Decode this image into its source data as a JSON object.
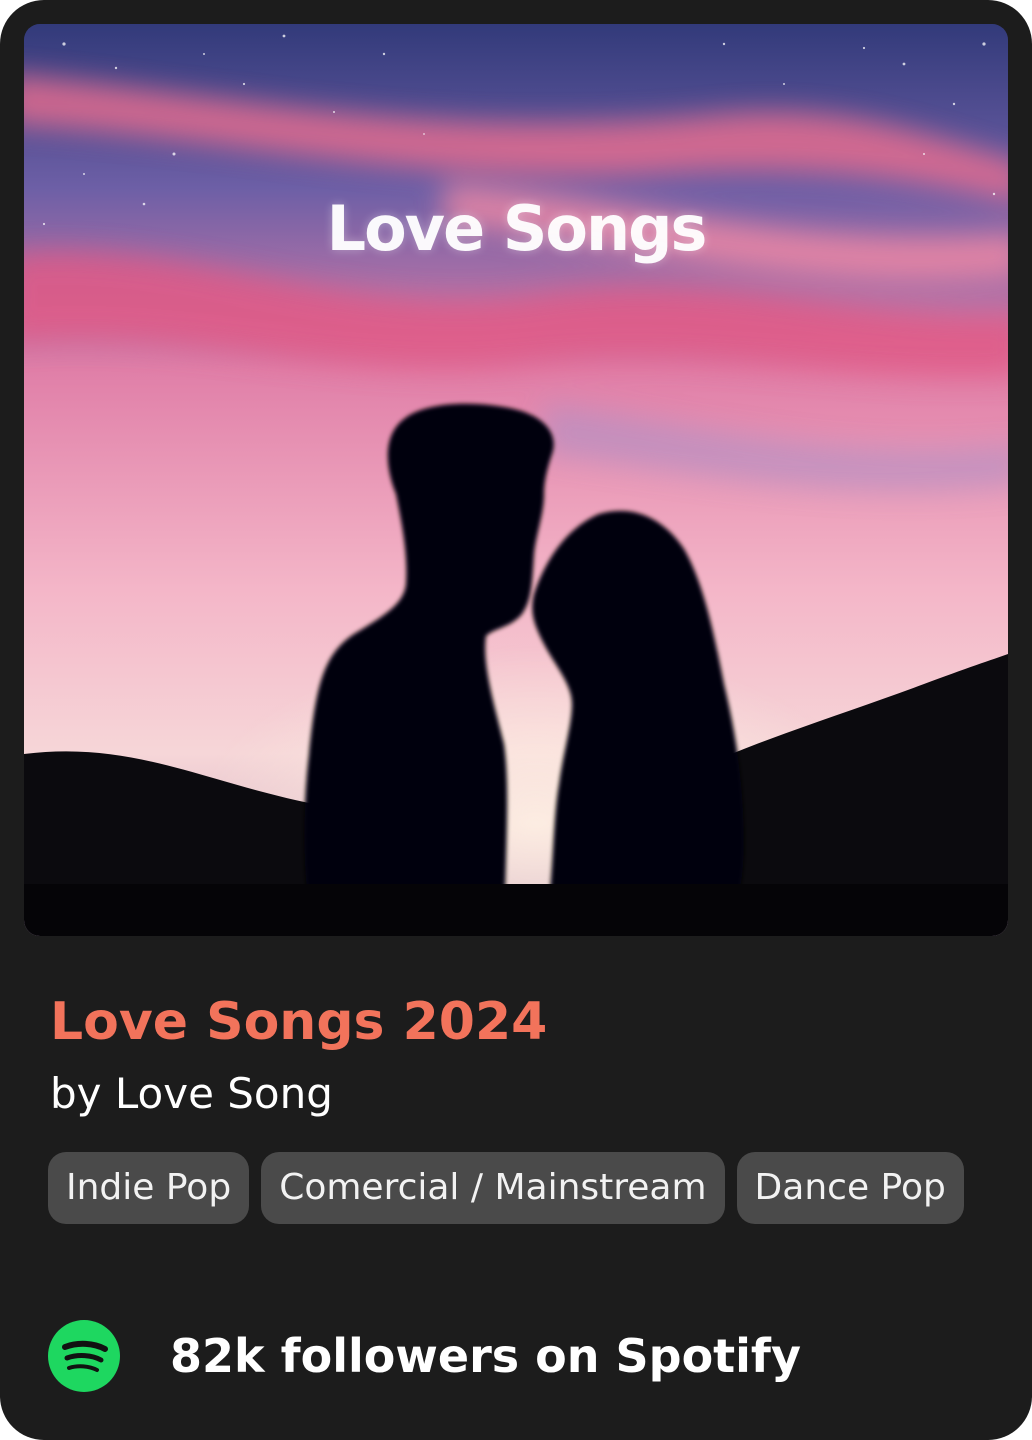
{
  "cover": {
    "title": "Love Songs",
    "image": "couple-silhouette-pink-sky"
  },
  "playlist": {
    "title": "Love Songs 2024",
    "author": "by Love Song",
    "title_color": "#f2735b"
  },
  "tags": [
    {
      "label": "Indie Pop"
    },
    {
      "label": "Comercial / Mainstream"
    },
    {
      "label": "Dance Pop"
    }
  ],
  "footer": {
    "icon": "spotify-icon",
    "followers_text": "82k followers on Spotify",
    "brand_color": "#1ed760"
  }
}
